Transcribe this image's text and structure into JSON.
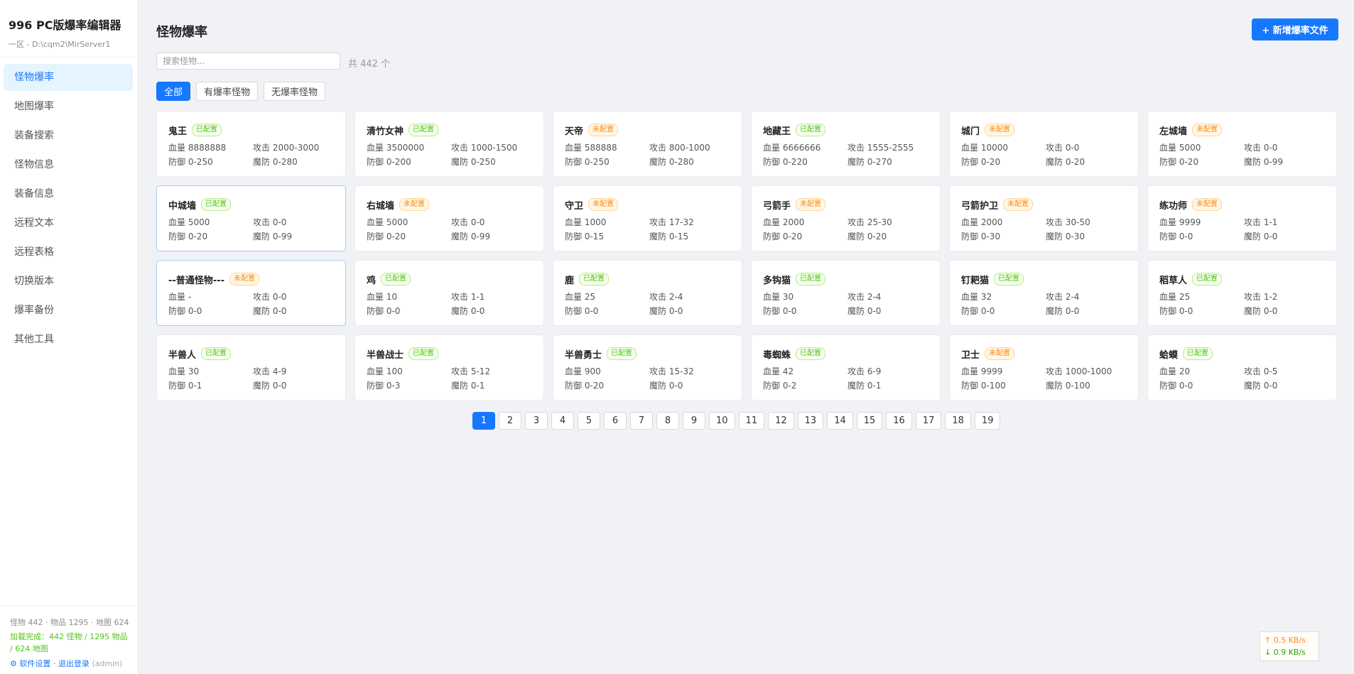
{
  "app": {
    "title": "996 PC版爆率编辑器",
    "path": "一区 - D:\\cqm2\\MirServer1"
  },
  "sidebar": {
    "items": [
      {
        "label": "怪物爆率",
        "active": true
      },
      {
        "label": "地图爆率"
      },
      {
        "label": "装备搜索"
      },
      {
        "label": "怪物信息"
      },
      {
        "label": "装备信息"
      },
      {
        "label": "远程文本"
      },
      {
        "label": "远程表格"
      },
      {
        "label": "切换版本"
      },
      {
        "label": "爆率备份"
      },
      {
        "label": "其他工具"
      }
    ],
    "footer": {
      "stats": "怪物 442 · 物品 1295 · 地图 624",
      "loaded": "加载完成：442 怪物 / 1295 物品 / 624 地图",
      "settings_icon": "gear-icon",
      "settings_label": "软件设置",
      "separator": "·",
      "logout_label": "退出登录",
      "user": "(admin)"
    }
  },
  "main": {
    "title": "怪物爆率",
    "add_button": "+ 新增爆率文件",
    "search_placeholder": "搜索怪物...",
    "count_text": "共 442 个",
    "filters": [
      "全部",
      "有爆率怪物",
      "无爆率怪物"
    ],
    "active_filter": "全部",
    "hp_label": "血量",
    "atk_label": "攻击",
    "def_label": "防御",
    "mdef_label": "魔防",
    "monsters": [
      {
        "name": "鬼王",
        "status": "已配置",
        "hp": "8888888",
        "atk": "2000-3000",
        "def": "0-250",
        "mdef": "0-280"
      },
      {
        "name": "清竹女神",
        "status": "已配置",
        "hp": "3500000",
        "atk": "1000-1500",
        "def": "0-200",
        "mdef": "0-250"
      },
      {
        "name": "天帝",
        "status": "未配置",
        "hp": "588888",
        "atk": "800-1000",
        "def": "0-250",
        "mdef": "0-280"
      },
      {
        "name": "地藏王",
        "status": "已配置",
        "hp": "6666666",
        "atk": "1555-2555",
        "def": "0-220",
        "mdef": "0-270"
      },
      {
        "name": "城门",
        "status": "未配置",
        "hp": "10000",
        "atk": "0-0",
        "def": "0-20",
        "mdef": "0-20"
      },
      {
        "name": "左城墙",
        "status": "未配置",
        "hp": "5000",
        "atk": "0-0",
        "def": "0-20",
        "mdef": "0-99"
      },
      {
        "name": "中城墙",
        "status": "已配置",
        "hp": "5000",
        "atk": "0-0",
        "def": "0-20",
        "mdef": "0-99"
      },
      {
        "name": "右城墙",
        "status": "未配置",
        "hp": "5000",
        "atk": "0-0",
        "def": "0-20",
        "mdef": "0-99"
      },
      {
        "name": "守卫",
        "status": "未配置",
        "hp": "1000",
        "atk": "17-32",
        "def": "0-15",
        "mdef": "0-15"
      },
      {
        "name": "弓箭手",
        "status": "未配置",
        "hp": "2000",
        "atk": "25-30",
        "def": "0-20",
        "mdef": "0-20"
      },
      {
        "name": "弓箭护卫",
        "status": "未配置",
        "hp": "2000",
        "atk": "30-50",
        "def": "0-30",
        "mdef": "0-30"
      },
      {
        "name": "练功师",
        "status": "未配置",
        "hp": "9999",
        "atk": "1-1",
        "def": "0-0",
        "mdef": "0-0"
      },
      {
        "name": "--普通怪物---",
        "status": "未配置",
        "hp": "-",
        "atk": "0-0",
        "def": "0-0",
        "mdef": "0-0"
      },
      {
        "name": "鸡",
        "status": "已配置",
        "hp": "10",
        "atk": "1-1",
        "def": "0-0",
        "mdef": "0-0"
      },
      {
        "name": "鹿",
        "status": "已配置",
        "hp": "25",
        "atk": "2-4",
        "def": "0-0",
        "mdef": "0-0"
      },
      {
        "name": "多钩猫",
        "status": "已配置",
        "hp": "30",
        "atk": "2-4",
        "def": "0-0",
        "mdef": "0-0"
      },
      {
        "name": "钉耙猫",
        "status": "已配置",
        "hp": "32",
        "atk": "2-4",
        "def": "0-0",
        "mdef": "0-0"
      },
      {
        "name": "稻草人",
        "status": "已配置",
        "hp": "25",
        "atk": "1-2",
        "def": "0-0",
        "mdef": "0-0"
      },
      {
        "name": "半兽人",
        "status": "已配置",
        "hp": "30",
        "atk": "4-9",
        "def": "0-1",
        "mdef": "0-0"
      },
      {
        "name": "半兽战士",
        "status": "已配置",
        "hp": "100",
        "atk": "5-12",
        "def": "0-3",
        "mdef": "0-1"
      },
      {
        "name": "半兽勇士",
        "status": "已配置",
        "hp": "900",
        "atk": "15-32",
        "def": "0-20",
        "mdef": "0-0"
      },
      {
        "name": "毒蜘蛛",
        "status": "已配置",
        "hp": "42",
        "atk": "6-9",
        "def": "0-2",
        "mdef": "0-1"
      },
      {
        "name": "卫士",
        "status": "未配置",
        "hp": "9999",
        "atk": "1000-1000",
        "def": "0-100",
        "mdef": "0-100"
      },
      {
        "name": "蛤蟆",
        "status": "已配置",
        "hp": "20",
        "atk": "0-5",
        "def": "0-0",
        "mdef": "0-0"
      }
    ],
    "highlighted_cards": [
      "中城墙",
      "--普通怪物---"
    ],
    "pagination": {
      "current": "1",
      "pages": [
        "1",
        "2",
        "3",
        "4",
        "5",
        "6",
        "7",
        "8",
        "9",
        "10",
        "11",
        "12",
        "13",
        "14",
        "15",
        "16",
        "17",
        "18",
        "19"
      ]
    }
  },
  "network": {
    "upload": "↑ 0.5 KB/s",
    "download": "↓ 0.9 KB/s"
  },
  "colors": {
    "accent": "#1677ff",
    "configured": "#52c41a",
    "unconfigured": "#fa8c16"
  }
}
